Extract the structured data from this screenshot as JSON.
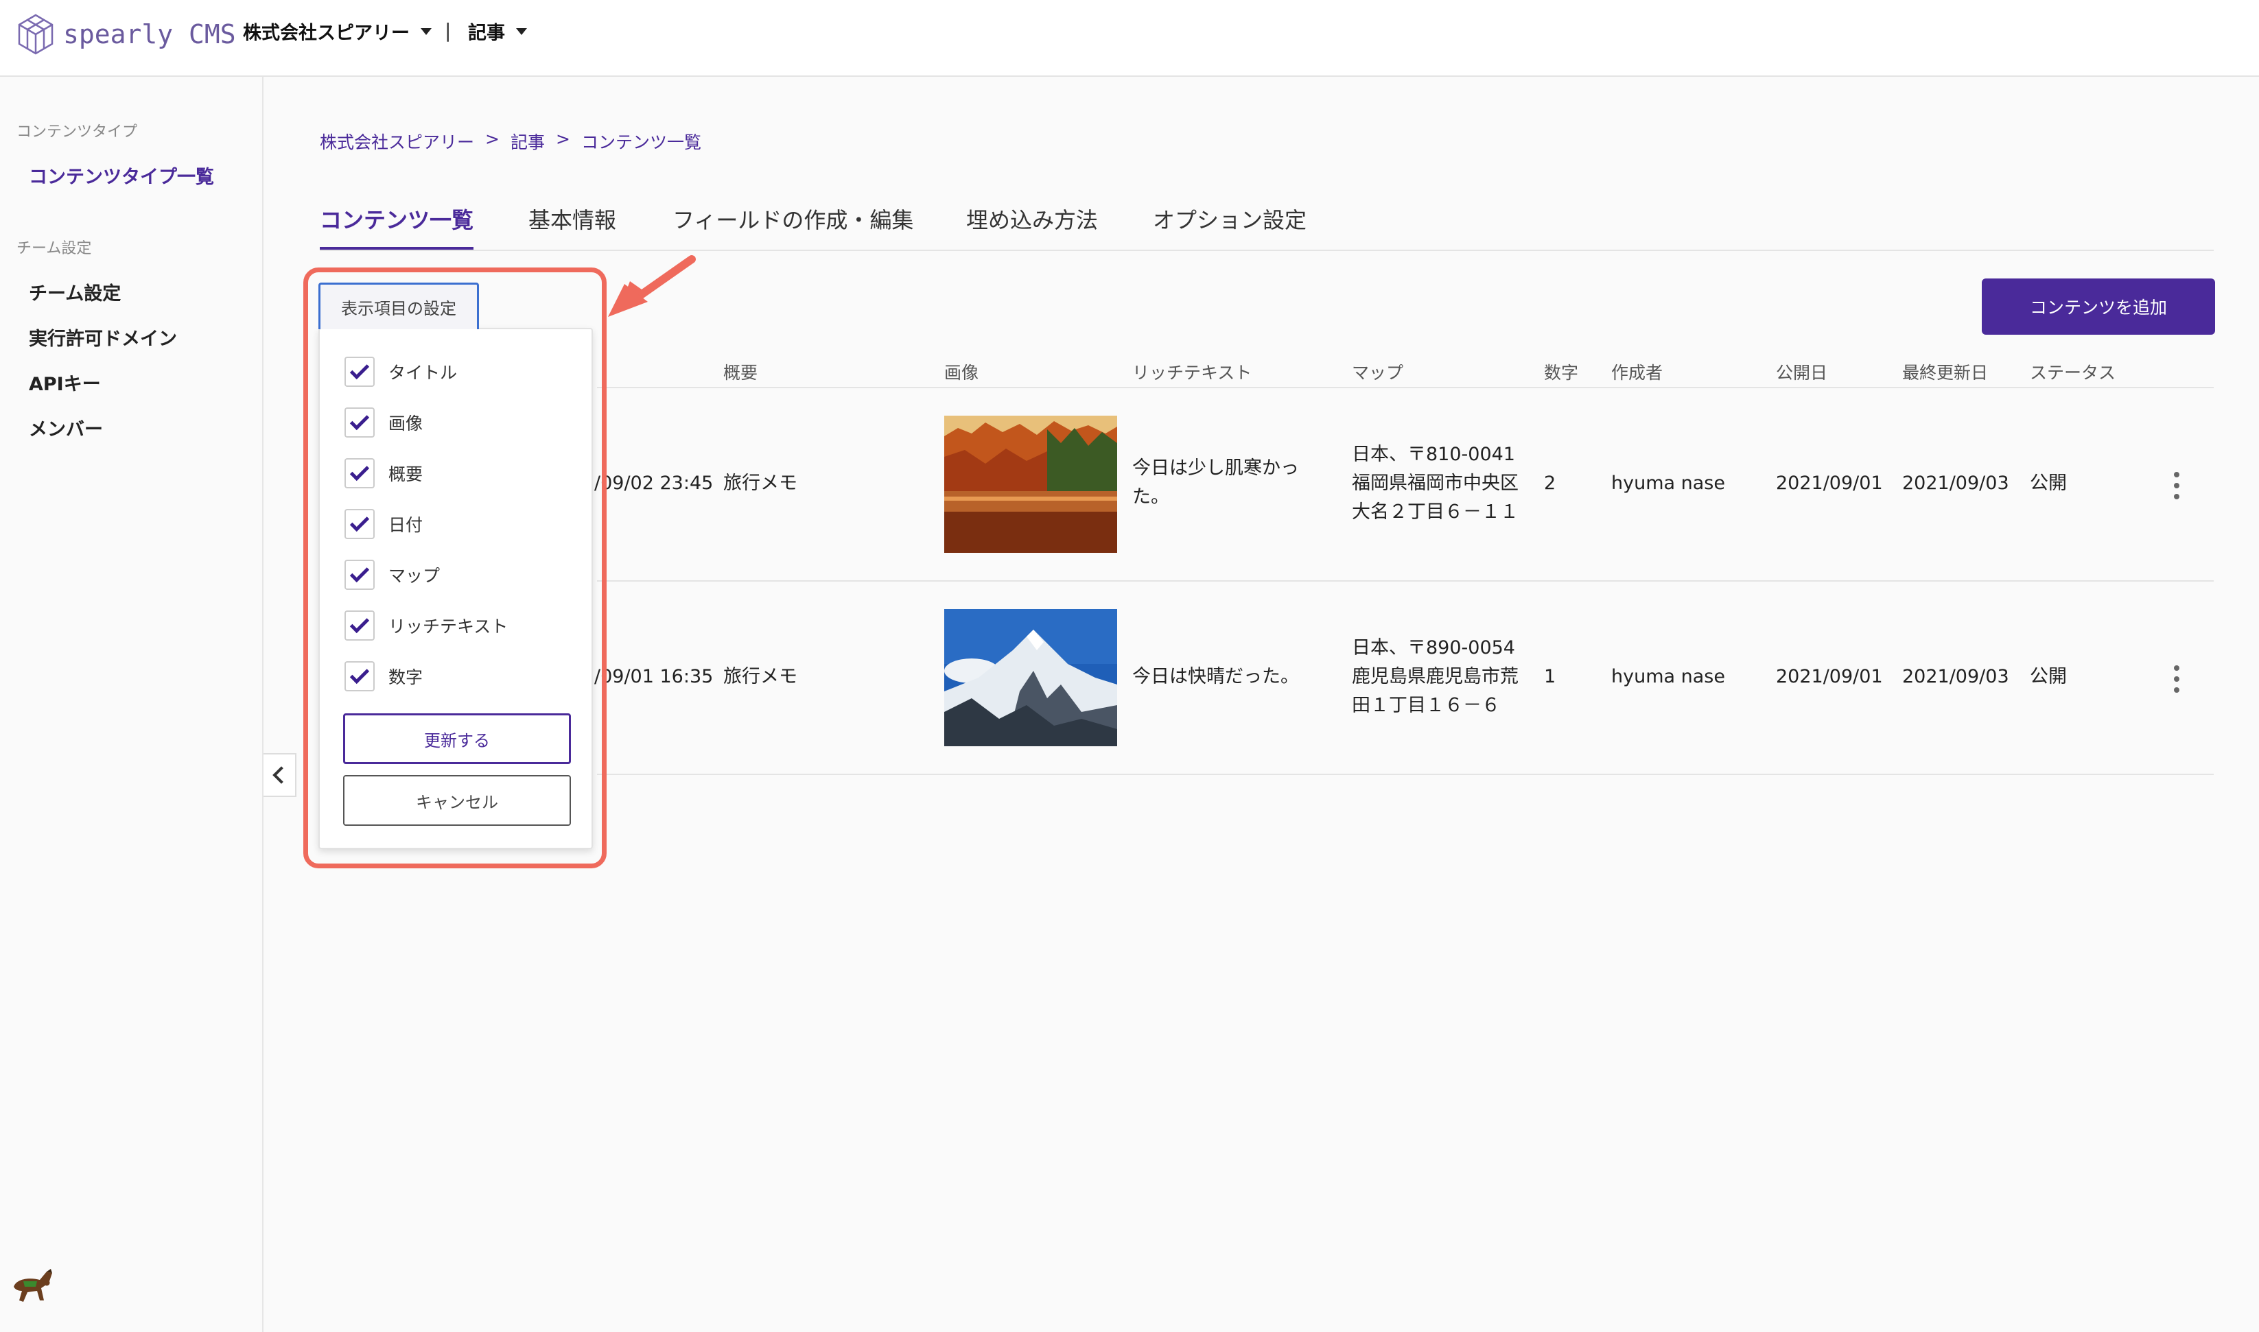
{
  "header": {
    "logo_text": "spearly CMS",
    "org_menu": "株式会社スピアリー",
    "separator": "|",
    "section_menu": "記事"
  },
  "sidebar": {
    "section1_title": "コンテンツタイプ",
    "item_content_types": "コンテンツタイプ一覧",
    "section2_title": "チーム設定",
    "item_team": "チーム設定",
    "item_domains": "実行許可ドメイン",
    "item_api": "APIキー",
    "item_members": "メンバー",
    "mascot_icon": "horse-icon"
  },
  "breadcrumb": {
    "items": [
      "株式会社スピアリー",
      "記事",
      "コンテンツ一覧"
    ],
    "sep": ">"
  },
  "tabs": [
    "コンテンツ一覧",
    "基本情報",
    "フィールドの作成・編集",
    "埋め込み方法",
    "オプション設定"
  ],
  "add_button": "コンテンツを追加",
  "table": {
    "headers": [
      "概要",
      "画像",
      "リッチテキスト",
      "マップ",
      "数字",
      "作成者",
      "公開日",
      "最終更新日",
      "ステータス"
    ],
    "rows": [
      {
        "date": "/09/02 23:45",
        "summary": "旅行メモ",
        "image": "autumn-lake",
        "rich1": "今日は少し肌寒かっ",
        "rich2": "た。",
        "map1": "日本、〒810-0041",
        "map2": "福岡県福岡市中央区",
        "map3": "大名２丁目６－１１",
        "number": "2",
        "author": "hyuma nase",
        "published": "2021/09/01",
        "updated": "2021/09/03",
        "status": "公開"
      },
      {
        "date": "/09/01 16:35",
        "summary": "旅行メモ",
        "image": "snow-mountain",
        "rich1": "今日は快晴だった。",
        "rich2": "",
        "map1": "日本、〒890-0054",
        "map2": "鹿児島県鹿児島市荒",
        "map3": "田１丁目１６－６",
        "number": "1",
        "author": "hyuma nase",
        "published": "2021/09/01",
        "updated": "2021/09/03",
        "status": "公開"
      }
    ]
  },
  "column_settings": {
    "toggle_label": "表示項目の設定",
    "options": [
      {
        "label": "タイトル",
        "checked": true
      },
      {
        "label": "画像",
        "checked": true
      },
      {
        "label": "概要",
        "checked": true
      },
      {
        "label": "日付",
        "checked": true
      },
      {
        "label": "マップ",
        "checked": true
      },
      {
        "label": "リッチテキスト",
        "checked": true
      },
      {
        "label": "数字",
        "checked": true
      }
    ],
    "update_button": "更新する",
    "cancel_button": "キャンセル"
  },
  "colors": {
    "accent": "#4a2a9a",
    "annotation": "#ef6a5c"
  }
}
